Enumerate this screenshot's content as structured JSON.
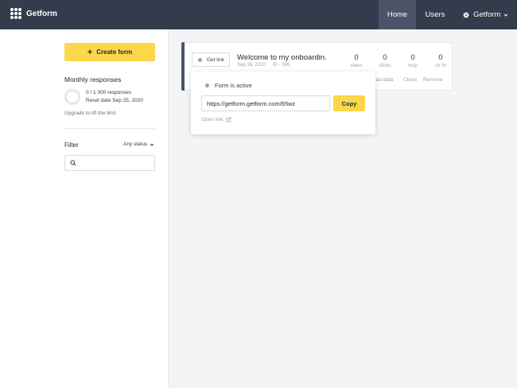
{
  "app": {
    "brand_name": "Getform",
    "logo_icon": "getform-logo-icon"
  },
  "nav": {
    "home": "Home",
    "users": "Users",
    "account": "Getform",
    "account_icon": "gear-icon",
    "account_chevron_icon": "chevron-down-icon"
  },
  "sidebar": {
    "create_button": "Create form",
    "monthly_title": "Monthly responses",
    "responses_count": "0 / 1 000 responses",
    "reset_date": "Reset date Sep 25, 2020",
    "responses_used_fraction": 0,
    "upgrade_link": "Upgrade to lift the limit",
    "filter_label": "Filter",
    "status_select": "Any status",
    "search_placeholder": ""
  },
  "form_card": {
    "get_link_label": "Get link",
    "title": "Welcome to my onboardin...",
    "date": "Sep 16, 2020",
    "id": "ID - 306",
    "stats": [
      {
        "value": "0",
        "label": "views"
      },
      {
        "value": "0",
        "label": "clicks"
      },
      {
        "value": "0",
        "label": "resp"
      },
      {
        "value": "0",
        "label": "ctr %"
      }
    ],
    "actions": [
      "oad data",
      "Clone",
      "Remove"
    ]
  },
  "popover": {
    "active_label": "Form is active",
    "url": "https://getform.getform.com/65wz",
    "copy_label": "Copy",
    "open_link_label": "Open link",
    "open_link_icon": "external-link-icon"
  },
  "colors": {
    "topbar": "#333c4d",
    "nav_active": "#4b5466",
    "accent_yellow": "#fcd74a",
    "page_bg": "#f3f4f6"
  }
}
